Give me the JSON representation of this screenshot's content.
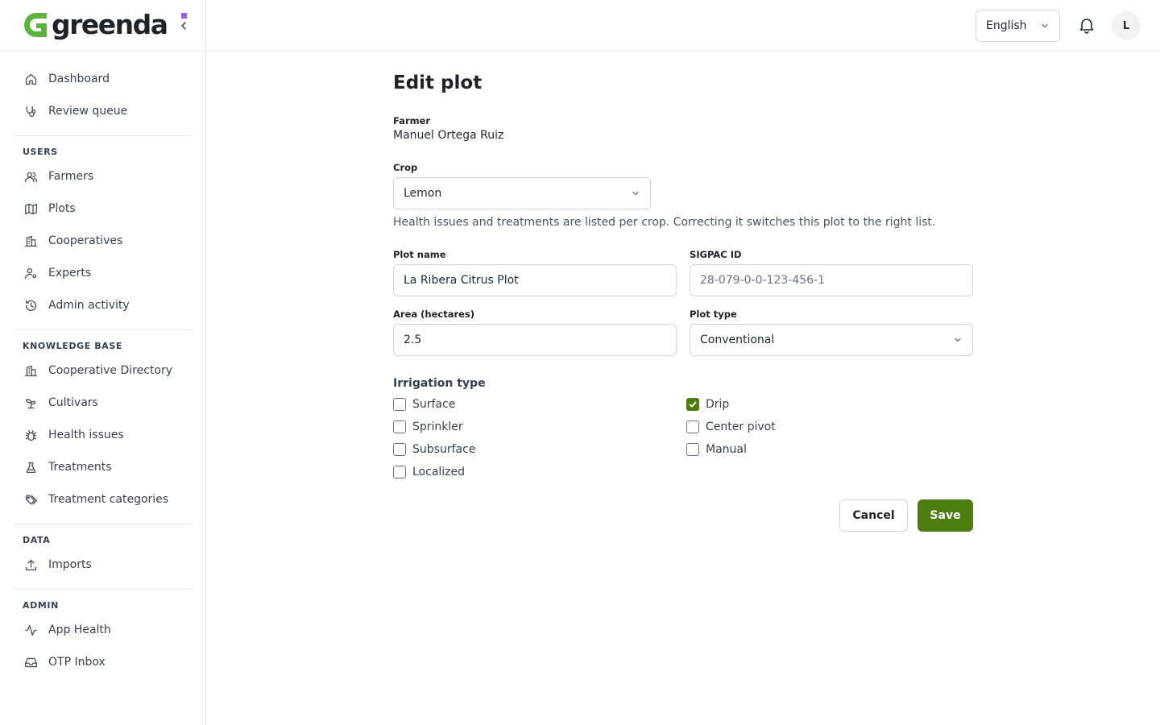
{
  "brand": {
    "name": "greenda",
    "accent": "#4d7c0f",
    "logo_green": "#5cb33a",
    "logo_dot": "#8b5cf6"
  },
  "sidebar": {
    "top_items": [
      {
        "label": "Dashboard",
        "icon": "home-icon"
      },
      {
        "label": "Review queue",
        "icon": "stethoscope-icon"
      }
    ],
    "sections": [
      {
        "title": "USERS",
        "items": [
          {
            "label": "Farmers",
            "icon": "users-icon"
          },
          {
            "label": "Plots",
            "icon": "map-icon"
          },
          {
            "label": "Cooperatives",
            "icon": "building-icon"
          },
          {
            "label": "Experts",
            "icon": "user-cog-icon"
          },
          {
            "label": "Admin activity",
            "icon": "history-icon"
          }
        ]
      },
      {
        "title": "KNOWLEDGE BASE",
        "items": [
          {
            "label": "Cooperative Directory",
            "icon": "building-icon"
          },
          {
            "label": "Cultivars",
            "icon": "sprout-icon"
          },
          {
            "label": "Health issues",
            "icon": "bug-icon"
          },
          {
            "label": "Treatments",
            "icon": "flask-icon"
          },
          {
            "label": "Treatment categories",
            "icon": "tags-icon"
          }
        ]
      },
      {
        "title": "DATA",
        "items": [
          {
            "label": "Imports",
            "icon": "upload-icon"
          }
        ]
      },
      {
        "title": "ADMIN",
        "items": [
          {
            "label": "App Health",
            "icon": "activity-icon"
          },
          {
            "label": "OTP Inbox",
            "icon": "inbox-icon"
          }
        ]
      }
    ]
  },
  "header": {
    "language": "English",
    "avatar_initial": "L"
  },
  "form": {
    "title": "Edit plot",
    "farmer_label": "Farmer",
    "farmer_name": "Manuel Ortega Ruiz",
    "crop_label": "Crop",
    "crop_value": "Lemon",
    "crop_help": "Health issues and treatments are listed per crop. Correcting it switches this plot to the right list.",
    "plot_name_label": "Plot name",
    "plot_name_value": "La Ribera Citrus Plot",
    "sigpac_label": "SIGPAC ID",
    "sigpac_placeholder": "28-079-0-0-123-456-1",
    "area_label": "Area (hectares)",
    "area_value": "2.5",
    "plot_type_label": "Plot type",
    "plot_type_value": "Conventional",
    "irrigation_label": "Irrigation type",
    "irrigation_options": [
      {
        "label": "Surface",
        "checked": false
      },
      {
        "label": "Drip",
        "checked": true
      },
      {
        "label": "Sprinkler",
        "checked": false
      },
      {
        "label": "Center pivot",
        "checked": false
      },
      {
        "label": "Subsurface",
        "checked": false
      },
      {
        "label": "Manual",
        "checked": false
      },
      {
        "label": "Localized",
        "checked": false
      }
    ],
    "cancel_label": "Cancel",
    "save_label": "Save"
  }
}
